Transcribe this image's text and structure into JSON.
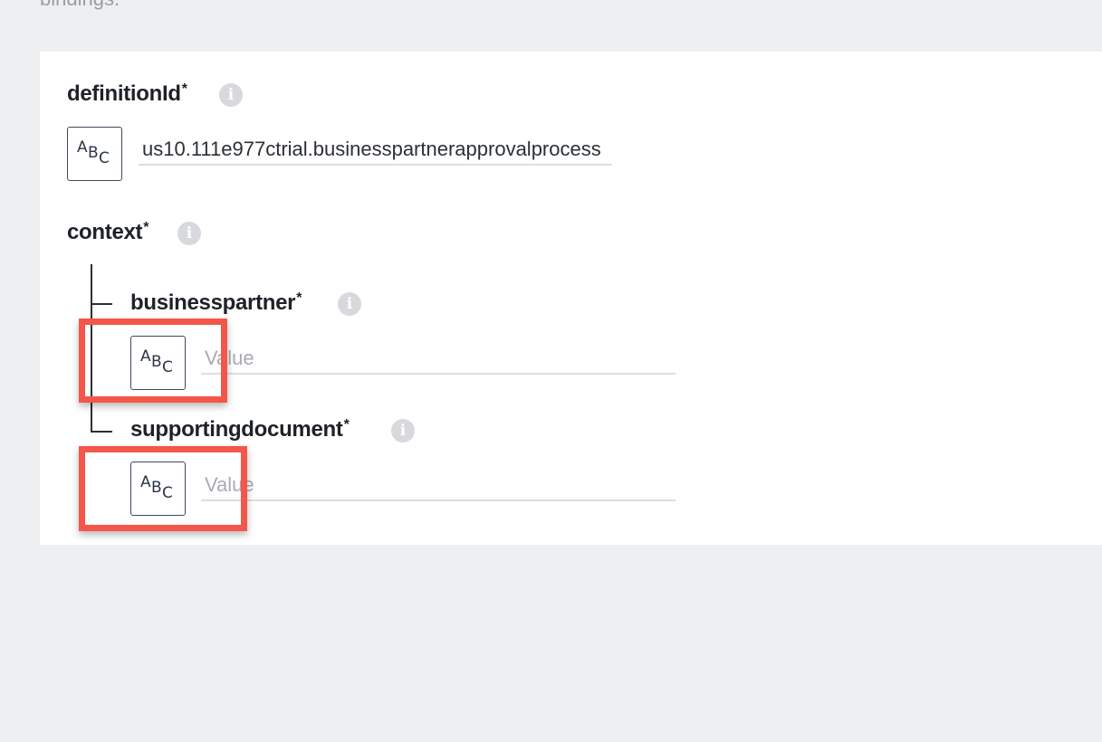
{
  "top_text": "bindings.",
  "fields": {
    "definitionId": {
      "label": "definitionId",
      "required_mark": "*",
      "value": "us10.111e977ctrial.businesspartnerapprovalprocess",
      "type_icon": "abc-type-icon"
    },
    "context": {
      "label": "context",
      "required_mark": "*",
      "children": [
        {
          "label": "businesspartner",
          "required_mark": "*",
          "placeholder": "Value",
          "type_icon": "abc-type-icon"
        },
        {
          "label": "supportingdocument",
          "required_mark": "*",
          "placeholder": "Value",
          "type_icon": "abc-type-icon"
        }
      ]
    }
  },
  "info_icon_glyph": "i",
  "type_icon_glyphs": [
    "A",
    "B",
    "C"
  ],
  "colors": {
    "background": "#eeeff1",
    "card": "#ffffff",
    "highlight": "#f2574a",
    "text": "#1e2228",
    "placeholder": "#a7abb1"
  }
}
